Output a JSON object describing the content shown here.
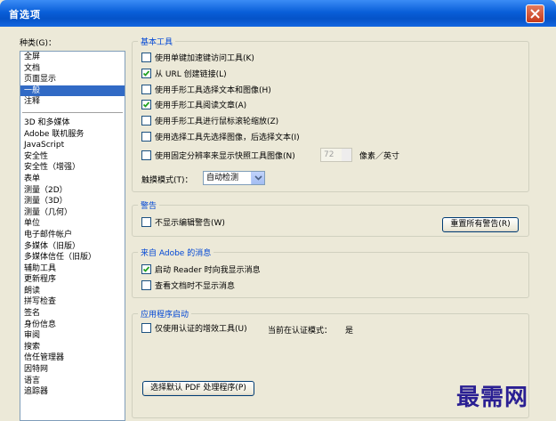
{
  "window": {
    "title": "首选项"
  },
  "categories": {
    "label": "种类(G)：",
    "items_top": [
      "全屏",
      "文档",
      "页面显示",
      "一般",
      "注释"
    ],
    "selected": "一般",
    "items_bottom": [
      "3D 和多媒体",
      "Adobe 联机服务",
      "JavaScript",
      "安全性",
      "安全性（增强）",
      "表单",
      "测量（2D）",
      "测量（3D）",
      "测量（几何）",
      "单位",
      "电子邮件帐户",
      "多媒体（旧版）",
      "多媒体信任（旧版）",
      "辅助工具",
      "更新程序",
      "朗读",
      "拼写检查",
      "签名",
      "身份信息",
      "审阅",
      "搜索",
      "信任管理器",
      "因特网",
      "语言",
      "追踪器"
    ]
  },
  "basic_tools": {
    "title": "基本工具",
    "options": [
      {
        "label": "使用单键加速键访问工具(K)",
        "checked": false
      },
      {
        "label": "从 URL 创建链接(L)",
        "checked": true
      },
      {
        "label": "使用手形工具选择文本和图像(H)",
        "checked": false
      },
      {
        "label": "使用手形工具阅读文章(A)",
        "checked": true
      },
      {
        "label": "使用手形工具进行鼠标滚轮缩放(Z)",
        "checked": false
      },
      {
        "label": "使用选择工具先选择图像，后选择文本(I)",
        "checked": false
      },
      {
        "label": "使用固定分辨率来显示快照工具图像(N)",
        "checked": false
      }
    ],
    "resolution_value": "72",
    "resolution_unit": "像素／英寸",
    "touch_mode_label": "触摸模式(T)：",
    "touch_mode_value": "自动检测"
  },
  "warnings": {
    "title": "警告",
    "option": {
      "label": "不显示编辑警告(W)",
      "checked": false
    },
    "reset_button": "重置所有警告(R)"
  },
  "adobe_messages": {
    "title": "来自 Adobe 的消息",
    "options": [
      {
        "label": "启动 Reader 时向我显示消息",
        "checked": true
      },
      {
        "label": "查看文档时不显示消息",
        "checked": false
      }
    ]
  },
  "app_startup": {
    "title": "应用程序启动",
    "option": {
      "label": "仅使用认证的增效工具(U)",
      "checked": false
    },
    "cert_mode_label": "当前在认证模式：",
    "cert_mode_value": "是",
    "default_pdf_button": "选择默认 PDF 处理程序(P)"
  },
  "watermark": "最需网",
  "colors": {
    "title_bar": "#0553c8",
    "selection": "#316ac5",
    "group_title": "#0046d5"
  }
}
